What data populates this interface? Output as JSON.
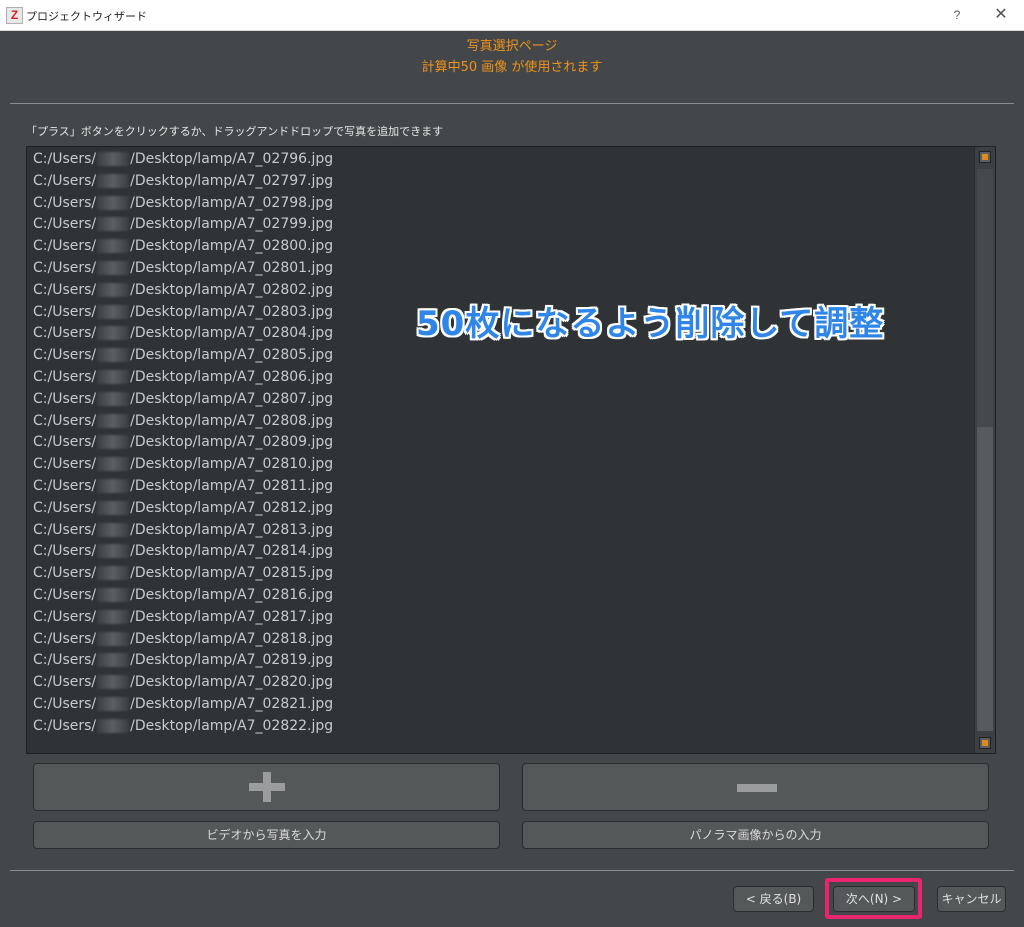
{
  "window": {
    "title": "プロジェクトウィザード",
    "app_icon_letter": "Z",
    "help_label": "?",
    "close_label": "✕"
  },
  "header": {
    "title": "写真選択ページ",
    "subtitle": "計算中50 画像 が使用されます"
  },
  "instruction": "「プラス」ボタンをクリックするか、ドラッグアンドドロップで写真を追加できます",
  "files": {
    "prefix": "C:/Users/",
    "suffix_path": "/Desktop/lamp/",
    "names": [
      "A7_02796.jpg",
      "A7_02797.jpg",
      "A7_02798.jpg",
      "A7_02799.jpg",
      "A7_02800.jpg",
      "A7_02801.jpg",
      "A7_02802.jpg",
      "A7_02803.jpg",
      "A7_02804.jpg",
      "A7_02805.jpg",
      "A7_02806.jpg",
      "A7_02807.jpg",
      "A7_02808.jpg",
      "A7_02809.jpg",
      "A7_02810.jpg",
      "A7_02811.jpg",
      "A7_02812.jpg",
      "A7_02813.jpg",
      "A7_02814.jpg",
      "A7_02815.jpg",
      "A7_02816.jpg",
      "A7_02817.jpg",
      "A7_02818.jpg",
      "A7_02819.jpg",
      "A7_02820.jpg",
      "A7_02821.jpg",
      "A7_02822.jpg"
    ]
  },
  "overlay_note": "50枚になるよう削除して調整",
  "buttons": {
    "video_input": "ビデオから写真を入力",
    "panorama_input": "パノラマ画像からの入力",
    "back": "< 戻る(B)",
    "next": "次へ(N) >",
    "cancel": "キャンセル"
  },
  "colors": {
    "accent": "#f0921a",
    "highlight": "#e8256e",
    "overlay_text": "#2f86e8"
  }
}
